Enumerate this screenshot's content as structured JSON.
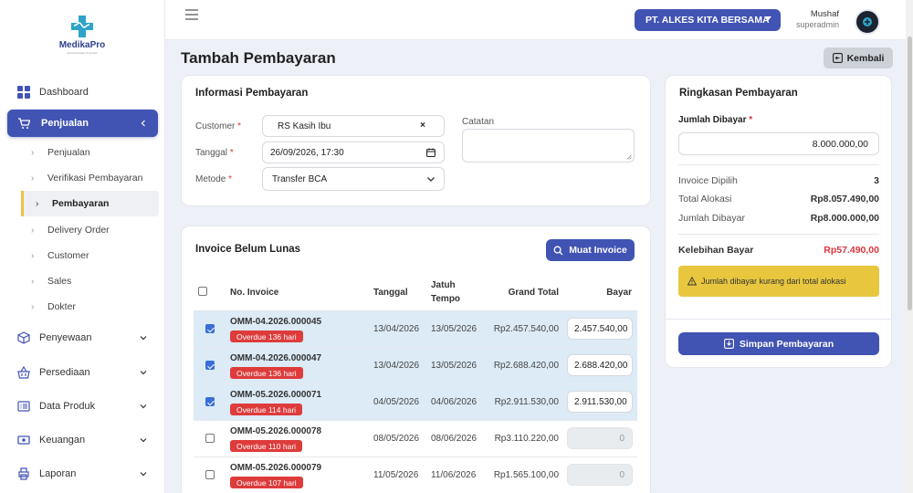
{
  "app": {
    "logo_text": "MedikaPro",
    "logo_subtext": "Alat Kesehatan & Apotek"
  },
  "sidebar": {
    "items": [
      {
        "label": "Dashboard",
        "icon": "dashboard-icon"
      },
      {
        "label": "Penjualan",
        "icon": "cart-icon",
        "active": true
      },
      {
        "label": "Penyewaan",
        "icon": "box-icon"
      },
      {
        "label": "Persediaan",
        "icon": "basket-icon"
      },
      {
        "label": "Data Produk",
        "icon": "list-icon"
      },
      {
        "label": "Keuangan",
        "icon": "money-icon"
      },
      {
        "label": "Laporan",
        "icon": "printer-icon"
      }
    ],
    "subitems": [
      {
        "label": "Penjualan"
      },
      {
        "label": "Verifikasi Pembayaran"
      },
      {
        "label": "Pembayaran",
        "active": true
      },
      {
        "label": "Delivery Order"
      },
      {
        "label": "Customer"
      },
      {
        "label": "Sales"
      },
      {
        "label": "Dokter"
      }
    ]
  },
  "topbar": {
    "company": "PT. ALKES KITA BERSAMA",
    "user_name": "Mushaf",
    "user_role": "superadmin"
  },
  "page": {
    "title": "Tambah Pembayaran",
    "back_label": "Kembali"
  },
  "info": {
    "title": "Informasi Pembayaran",
    "customer_label": "Customer",
    "customer_value": "RS Kasih Ibu",
    "tanggal_label": "Tanggal",
    "tanggal_value": "26/09/2026, 17:30",
    "metode_label": "Metode",
    "metode_value": "Transfer BCA",
    "catatan_label": "Catatan",
    "required_mark": "*"
  },
  "invoices": {
    "title": "Invoice Belum Lunas",
    "load_button": "Muat Invoice",
    "headers": {
      "no": "No. Invoice",
      "tanggal": "Tanggal",
      "jatuh_1": "Jatuh",
      "jatuh_2": "Tempo",
      "grand": "Grand Total",
      "bayar": "Bayar"
    },
    "rows": [
      {
        "no": "OMM-04.2026.000045",
        "badge": "Overdue 136 hari",
        "tanggal": "13/04/2026",
        "jatuh": "13/05/2026",
        "grand": "Rp2.457.540,00",
        "bayar": "2.457.540,00",
        "checked": true
      },
      {
        "no": "OMM-04.2026.000047",
        "badge": "Overdue 136 hari",
        "tanggal": "13/04/2026",
        "jatuh": "13/05/2026",
        "grand": "Rp2.688.420,00",
        "bayar": "2.688.420,00",
        "checked": true
      },
      {
        "no": "OMM-05.2026.000071",
        "badge": "Overdue 114 hari",
        "tanggal": "04/05/2026",
        "jatuh": "04/06/2026",
        "grand": "Rp2.911.530,00",
        "bayar": "2.911.530,00",
        "checked": true
      },
      {
        "no": "OMM-05.2026.000078",
        "badge": "Overdue 110 hari",
        "tanggal": "08/05/2026",
        "jatuh": "08/06/2026",
        "grand": "Rp3.110.220,00",
        "bayar": "0",
        "checked": false
      },
      {
        "no": "OMM-05.2026.000079",
        "badge": "Overdue 107 hari",
        "tanggal": "11/05/2026",
        "jatuh": "11/06/2026",
        "grand": "Rp1.565.100,00",
        "bayar": "0",
        "checked": false
      }
    ]
  },
  "summary": {
    "title": "Ringkasan Pembayaran",
    "jumlah_label": "Jumlah Dibayar",
    "jumlah_value": "8.000.000,00",
    "invoice_dipilih_label": "Invoice Dipilih",
    "invoice_dipilih_value": "3",
    "total_alokasi_label": "Total Alokasi",
    "total_alokasi_value": "Rp8.057.490,00",
    "jumlah_dibayar_label": "Jumlah Dibayar",
    "jumlah_dibayar_value": "Rp8.000.000,00",
    "kelebihan_label": "Kelebihan Bayar",
    "kelebihan_value": "Rp57.490,00",
    "warning": "Jumlah dibayar kurang dari total alokasi",
    "save_button": "Simpan Pembayaran"
  },
  "colors": {
    "primary": "#4153b3",
    "danger": "#de3b3b",
    "warning": "#e8c73e",
    "selected_row": "#dcebf6"
  }
}
